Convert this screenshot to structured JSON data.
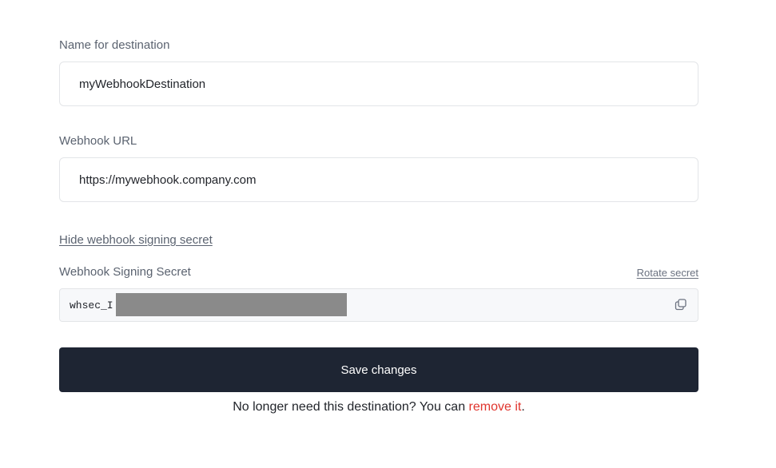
{
  "destination_name": {
    "label": "Name for destination",
    "value": "myWebhookDestination"
  },
  "webhook_url": {
    "label": "Webhook URL",
    "value": "https://mywebhook.company.com"
  },
  "secret": {
    "toggle_label": "Hide webhook signing secret",
    "label": "Webhook Signing Secret",
    "rotate_label": "Rotate secret",
    "value_prefix": "whsec_I",
    "copy_icon": "copy-icon"
  },
  "actions": {
    "save_label": "Save changes"
  },
  "footer": {
    "prefix": "No longer need this destination? You can ",
    "link_label": "remove it",
    "suffix": "."
  },
  "colors": {
    "primary_button": "#1e2533",
    "danger_link": "#e0342d",
    "secret_background": "#f7f8fa"
  }
}
